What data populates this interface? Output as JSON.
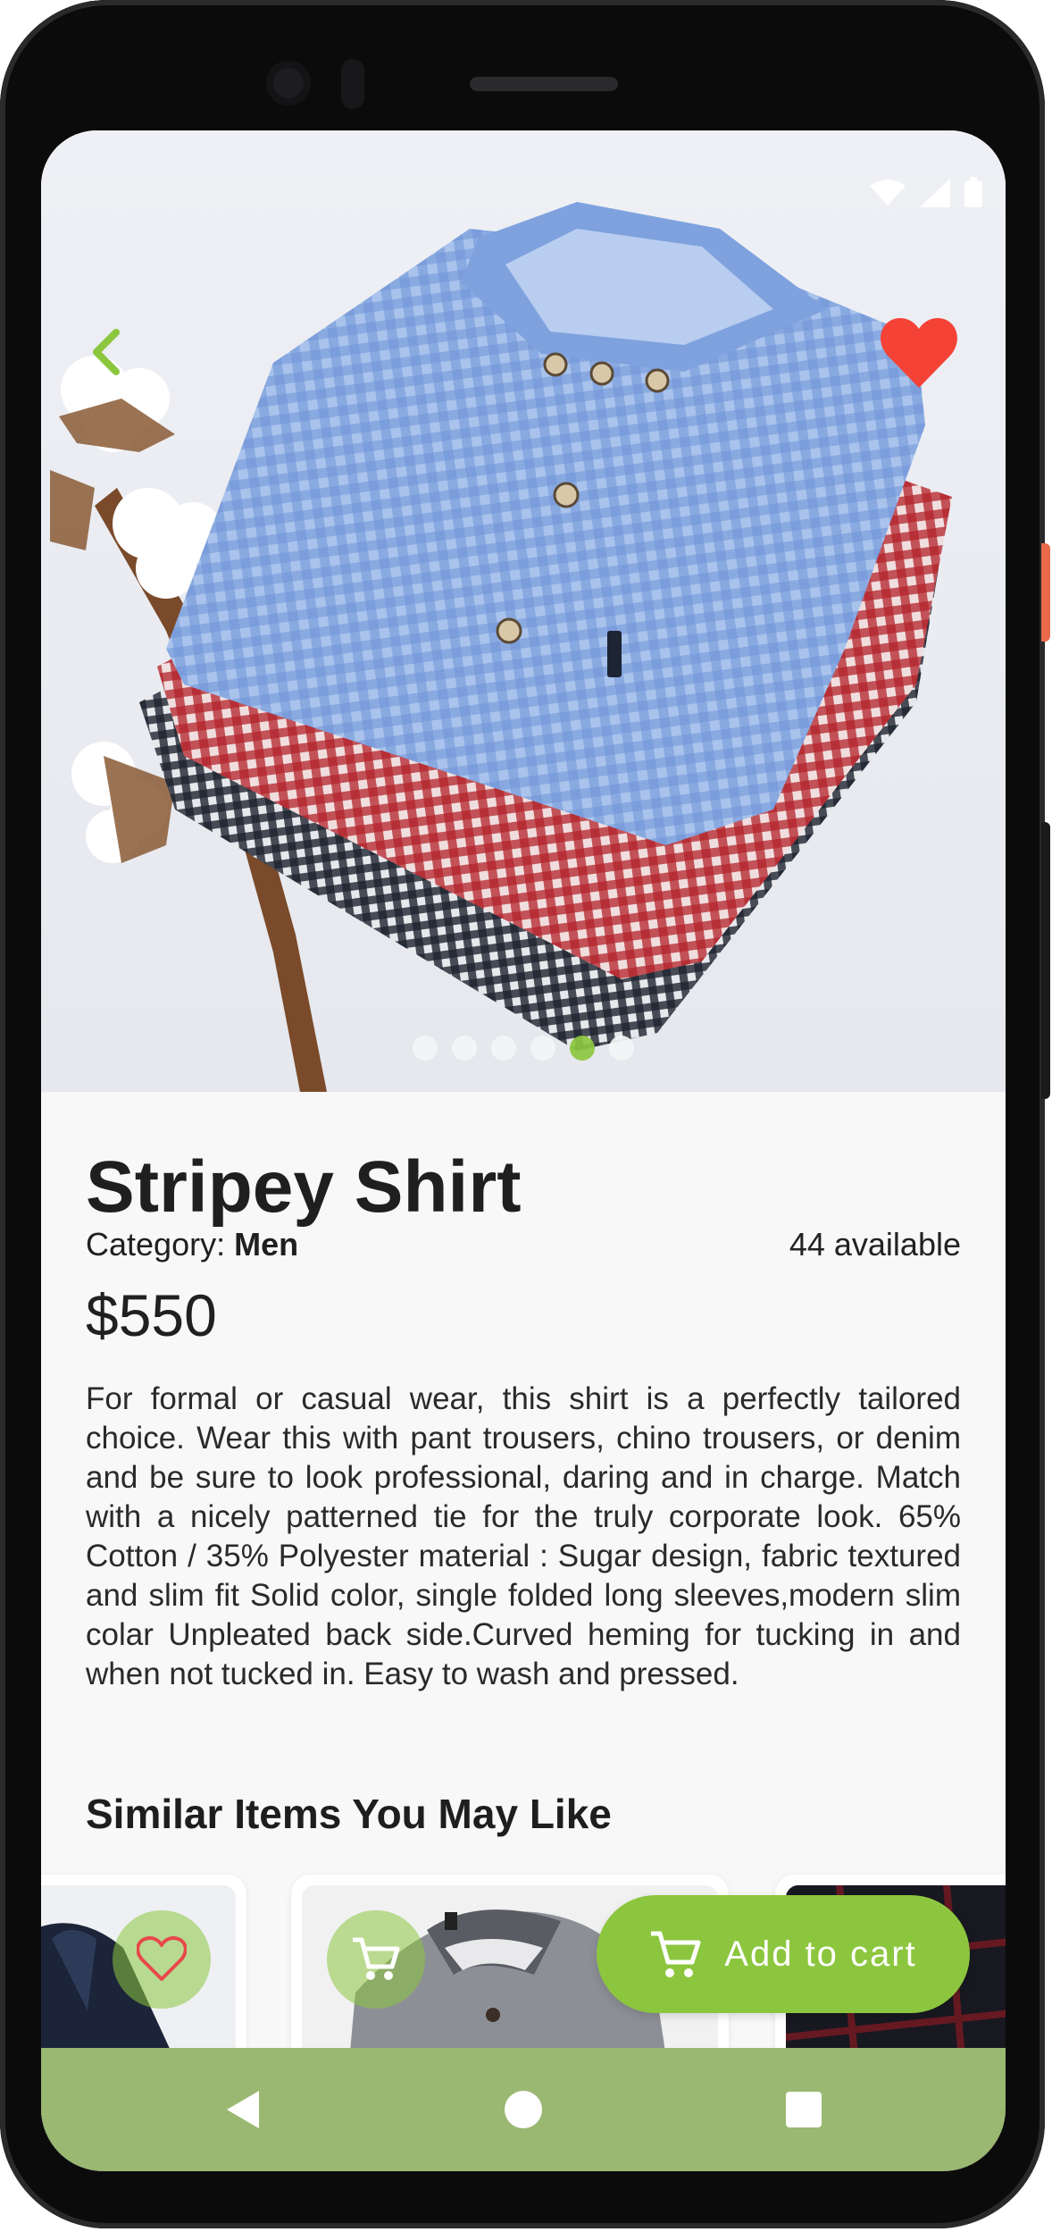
{
  "product": {
    "title": "Stripey Shirt",
    "category_prefix": "Category: ",
    "category": "Men",
    "available": "44 available",
    "price": "$550",
    "description": "For formal or casual wear, this shirt is a perfectly tailored choice. Wear this with pant trousers, chino trousers, or denim and be sure to look professional, daring and in charge. Match with a nicely patterned tie for the truly corporate look.  65% Cotton / 35% Polyester  material : Sugar design, fabric textured and slim fit  Solid color, single folded long sleeves,modern slim colar  Unpleated back side.Curved heming for tucking in and when not tucked in.  Easy to wash and pressed."
  },
  "carousel": {
    "total": 6,
    "active_index": 4
  },
  "similar": {
    "title": "Similar Items You May Like"
  },
  "actions": {
    "add_to_cart": "Add to cart"
  },
  "colors": {
    "accent": "#8cc63e",
    "favorite": "#f44336",
    "navbar": "#9ab872"
  },
  "icons": {
    "back": "chevron-left-icon",
    "favorite": "heart-filled-icon",
    "cart": "shopping-cart-icon",
    "heart_outline": "heart-outline-icon"
  }
}
